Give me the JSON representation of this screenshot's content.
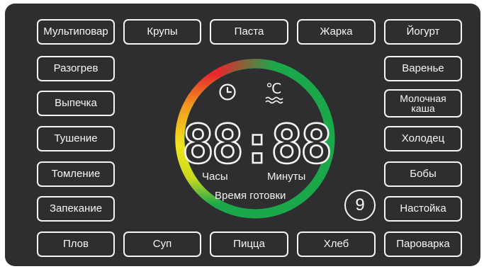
{
  "colors": {
    "panel": "#2e2e30",
    "text": "#f7f7f7",
    "ring_red": "#e8262c",
    "ring_orange": "#f39a1e",
    "ring_yellow": "#f0e41e",
    "ring_green": "#1aa84a"
  },
  "programs": {
    "top": [
      "Мультиповар",
      "Крупы",
      "Паста",
      "Жарка",
      "Йогурт"
    ],
    "left": [
      "Разогрев",
      "Выпечка",
      "Тушение",
      "Томление",
      "Запекание"
    ],
    "right": [
      "Варенье",
      "Молочная\nкаша",
      "Холодец",
      "Бобы",
      "Настойка"
    ],
    "bottom": [
      "Плов",
      "Суп",
      "Пицца",
      "Хлеб",
      "Пароварка"
    ]
  },
  "display": {
    "time": "88:88",
    "hours_label": "Часы",
    "minutes_label": "Минуты",
    "caption": "Время готовки",
    "clock_icon": "clock-icon",
    "temperature_icon": "temperature-icon",
    "temperature_unit": "℃"
  },
  "program_number": "9"
}
